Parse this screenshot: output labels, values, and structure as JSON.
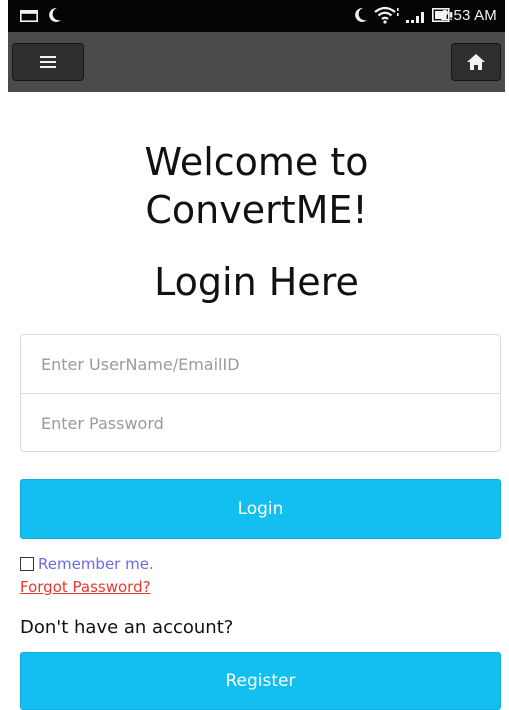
{
  "status_bar": {
    "time": "2:53 AM",
    "icons": [
      "mail-icon",
      "moon-icon",
      "moon-icon",
      "wifi-icon",
      "signal-icon",
      "battery-icon"
    ],
    "background": "#050505"
  },
  "toolbar": {
    "menu_icon": "hamburger-menu-icon",
    "home_icon": "home-icon",
    "background": "#4a4a4a"
  },
  "header": {
    "welcome_line1": "Welcome to",
    "welcome_line2": "ConvertME!",
    "login_title": "Login Here"
  },
  "form": {
    "username_placeholder": "Enter UserName/EmailID",
    "username_value": "",
    "password_placeholder": "Enter Password",
    "password_value": "",
    "login_label": "Login",
    "remember_label": "Remember me.",
    "remember_checked": false,
    "forgot_label": "Forgot Password?",
    "no_account_text": "Don't have an account?",
    "register_label": "Register"
  },
  "colors": {
    "accent": "#12bff0",
    "link_red": "#e8382e",
    "label_purple": "#6a6ae8"
  }
}
